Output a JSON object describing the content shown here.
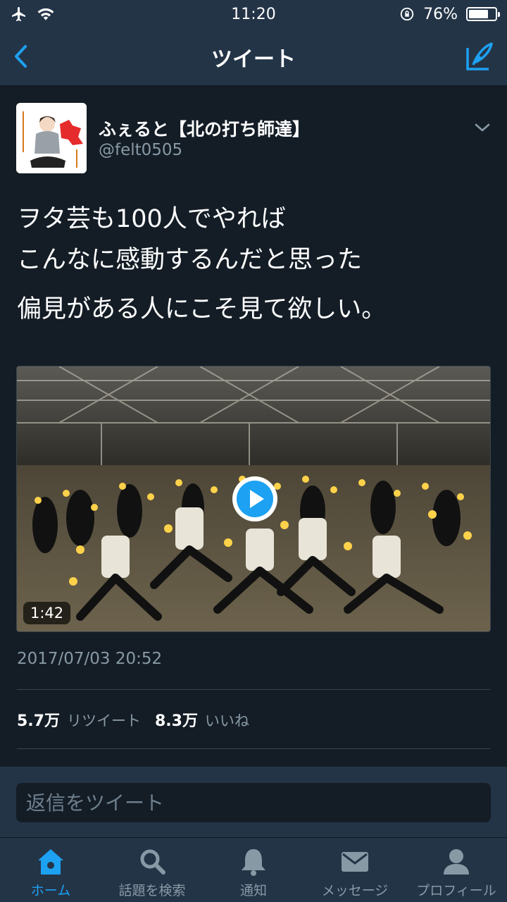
{
  "status_bar": {
    "time": "11:20",
    "battery": "76%",
    "battery_level": 0.76
  },
  "nav": {
    "title": "ツイート",
    "accent_color": "#1da1f2"
  },
  "tweet": {
    "display_name": "ふぇると【北の打ち師達】",
    "handle": "@felt0505",
    "text_lines": [
      "ヲタ芸も100人でやれば",
      "こんなに感動するんだと思った",
      "偏見がある人にこそ見て欲しい。"
    ],
    "video_duration": "1:42",
    "timestamp": "2017/07/03 20:52",
    "retweets_count": "5.7万",
    "retweets_label": "リツイート",
    "likes_count": "8.3万",
    "likes_label": "いいね"
  },
  "reply": {
    "placeholder": "返信をツイート"
  },
  "tabbar": {
    "tabs": [
      {
        "label": "ホーム",
        "icon": "home-icon",
        "active": true
      },
      {
        "label": "話題を検索",
        "icon": "search-icon",
        "active": false
      },
      {
        "label": "通知",
        "icon": "bell-icon",
        "active": false
      },
      {
        "label": "メッセージ",
        "icon": "envelope-icon",
        "active": false
      },
      {
        "label": "プロフィール",
        "icon": "person-icon",
        "active": false
      }
    ]
  }
}
